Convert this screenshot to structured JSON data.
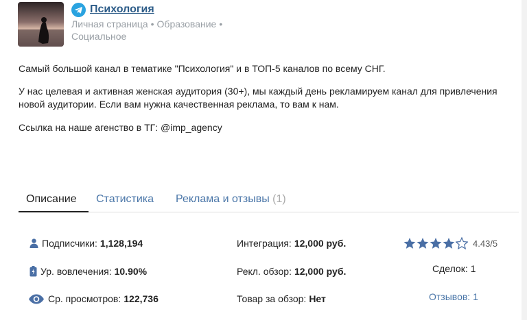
{
  "channel": {
    "title": "Психология",
    "type": "Личная страница",
    "category": "Образование",
    "subcategory": "Социальное",
    "separator": "•"
  },
  "description": {
    "line1": "Самый большой канал в тематике \"Психология\" и в ТОП-5 каналов по всему СНГ.",
    "line2": "У нас целевая и активная женская аудитория (30+), мы каждый день рекламируем канал для привлечения новой аудитории. Если вам нужна качественная реклама, то вам к нам.",
    "line3": "Ссылка на наше агенство в ТГ: @imp_agency"
  },
  "tabs": [
    {
      "label": "Описание",
      "active": true
    },
    {
      "label": "Статистика"
    },
    {
      "label": "Реклама и отзывы",
      "count": "(1)"
    }
  ],
  "stats": {
    "subscribers": {
      "label": "Подписчики:",
      "value": "1,128,194"
    },
    "engagement": {
      "label": "Ур. вовлечения:",
      "value": "10.90%"
    },
    "views": {
      "label": "Ср. просмотров:",
      "value": "122,736"
    },
    "integration": {
      "label": "Интеграция:",
      "value": "12,000 руб."
    },
    "review": {
      "label": "Рекл. обзор:",
      "value": "12,000 руб."
    },
    "product": {
      "label": "Товар за обзор:",
      "value": "Нет"
    },
    "rating": {
      "value": "4.43/5",
      "filled_stars": 4,
      "total_stars": 5
    },
    "deals": {
      "label": "Сделок: 1"
    },
    "reviews": {
      "label": "Отзывов: 1"
    }
  },
  "colors": {
    "link": "#4a76a8",
    "title": "#2d5c88",
    "telegram": "#2aa3e0",
    "muted": "#9aa0a6",
    "star_fill": "#4a6fa5"
  }
}
